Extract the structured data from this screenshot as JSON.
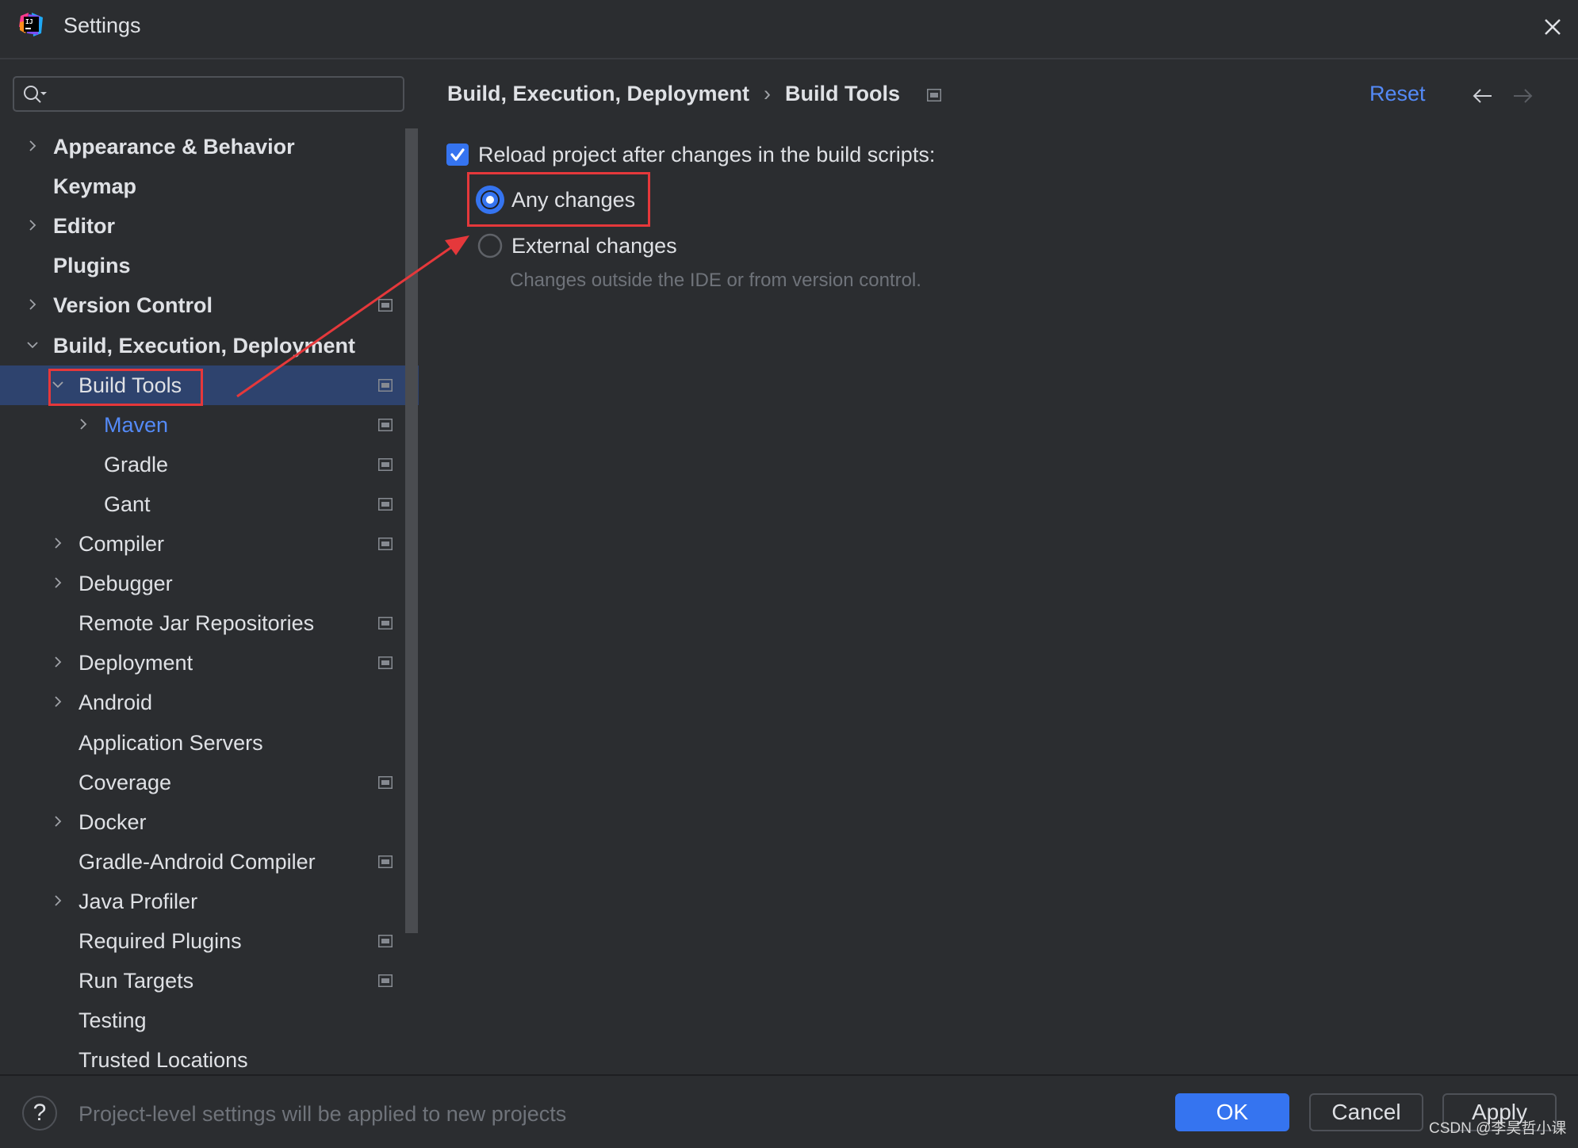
{
  "window": {
    "title": "Settings",
    "app_icon": "intellij-idea-icon",
    "close_icon": "close-icon"
  },
  "search": {
    "value": "",
    "placeholder": "",
    "icon": "search-icon"
  },
  "tree": {
    "items": [
      {
        "label": "Appearance & Behavior",
        "level": 0,
        "expandable": true,
        "expanded": false,
        "bold": true,
        "scope_icon": false
      },
      {
        "label": "Keymap",
        "level": 0,
        "expandable": false,
        "bold": true,
        "scope_icon": false
      },
      {
        "label": "Editor",
        "level": 0,
        "expandable": true,
        "expanded": false,
        "bold": true,
        "scope_icon": false
      },
      {
        "label": "Plugins",
        "level": 0,
        "expandable": false,
        "bold": true,
        "scope_icon": false
      },
      {
        "label": "Version Control",
        "level": 0,
        "expandable": true,
        "expanded": false,
        "bold": true,
        "scope_icon": true
      },
      {
        "label": "Build, Execution, Deployment",
        "level": 0,
        "expandable": true,
        "expanded": true,
        "bold": true,
        "scope_icon": false
      },
      {
        "label": "Build Tools",
        "level": 1,
        "expandable": true,
        "expanded": true,
        "selected": true,
        "scope_icon": true
      },
      {
        "label": "Maven",
        "level": 2,
        "expandable": true,
        "expanded": false,
        "highlighted": true,
        "scope_icon": true
      },
      {
        "label": "Gradle",
        "level": 2,
        "expandable": false,
        "scope_icon": true
      },
      {
        "label": "Gant",
        "level": 2,
        "expandable": false,
        "scope_icon": true
      },
      {
        "label": "Compiler",
        "level": 1,
        "expandable": true,
        "expanded": false,
        "scope_icon": true
      },
      {
        "label": "Debugger",
        "level": 1,
        "expandable": true,
        "expanded": false,
        "scope_icon": false
      },
      {
        "label": "Remote Jar Repositories",
        "level": 1,
        "expandable": false,
        "scope_icon": true
      },
      {
        "label": "Deployment",
        "level": 1,
        "expandable": true,
        "expanded": false,
        "scope_icon": true
      },
      {
        "label": "Android",
        "level": 1,
        "expandable": true,
        "expanded": false,
        "scope_icon": false
      },
      {
        "label": "Application Servers",
        "level": 1,
        "expandable": false,
        "scope_icon": false
      },
      {
        "label": "Coverage",
        "level": 1,
        "expandable": false,
        "scope_icon": true
      },
      {
        "label": "Docker",
        "level": 1,
        "expandable": true,
        "expanded": false,
        "scope_icon": false
      },
      {
        "label": "Gradle-Android Compiler",
        "level": 1,
        "expandable": false,
        "scope_icon": true
      },
      {
        "label": "Java Profiler",
        "level": 1,
        "expandable": true,
        "expanded": false,
        "scope_icon": false
      },
      {
        "label": "Required Plugins",
        "level": 1,
        "expandable": false,
        "scope_icon": true
      },
      {
        "label": "Run Targets",
        "level": 1,
        "expandable": false,
        "scope_icon": true
      },
      {
        "label": "Testing",
        "level": 1,
        "expandable": false,
        "scope_icon": false
      },
      {
        "label": "Trusted Locations",
        "level": 1,
        "expandable": false,
        "scope_icon": false
      }
    ]
  },
  "content": {
    "breadcrumb": [
      "Build, Execution, Deployment",
      "Build Tools"
    ],
    "breadcrumb_separator": "›",
    "reset_label": "Reset",
    "nav_back_icon": "arrow-left-icon",
    "nav_forward_icon": "arrow-right-icon",
    "reload_checkbox": {
      "label": "Reload project after changes in the build scripts:",
      "checked": true
    },
    "radio_options": [
      {
        "label": "Any changes",
        "selected": true
      },
      {
        "label": "External changes",
        "selected": false
      }
    ],
    "external_hint": "Changes outside the IDE or from version control."
  },
  "footer": {
    "help_label": "?",
    "info_text": "Project-level settings will be applied to new projects",
    "ok_label": "OK",
    "cancel_label": "Cancel",
    "apply_label": "Apply"
  },
  "watermark": "CSDN @李昊哲小课",
  "colors": {
    "accent": "#3574f0",
    "link": "#548af7",
    "selection": "#2e436e",
    "annotation": "#e5383b",
    "background": "#2b2d30"
  }
}
